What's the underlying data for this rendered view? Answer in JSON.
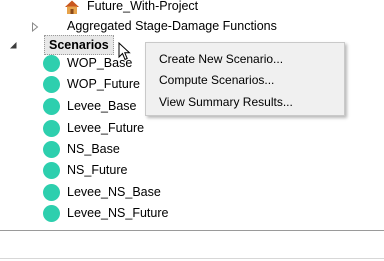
{
  "tree": {
    "partial_item": {
      "label": "Future_With-Project",
      "icon": "house-icon"
    },
    "aggregated_item": {
      "label": "Aggregated Stage-Damage Functions",
      "icon": "collapsed-triangle-icon"
    },
    "scenarios_folder": {
      "label": "Scenarios",
      "icon": "expanded-triangle-icon"
    },
    "scenarios": [
      {
        "label": "WOP_Base",
        "icon": "status-circle-icon"
      },
      {
        "label": "WOP_Future",
        "icon": "status-circle-icon"
      },
      {
        "label": "Levee_Base",
        "icon": "status-circle-icon"
      },
      {
        "label": "Levee_Future",
        "icon": "status-circle-icon"
      },
      {
        "label": "NS_Base",
        "icon": "status-circle-icon"
      },
      {
        "label": "NS_Future",
        "icon": "status-circle-icon"
      },
      {
        "label": "Levee_NS_Base",
        "icon": "status-circle-icon"
      },
      {
        "label": "Levee_NS_Future",
        "icon": "status-circle-icon"
      }
    ]
  },
  "context_menu": {
    "items": [
      {
        "label": "Create New Scenario..."
      },
      {
        "label": "Compute Scenarios..."
      },
      {
        "label": "View Summary Results..."
      }
    ]
  },
  "colors": {
    "status_circle": "#2dcfae",
    "menu_background": "#f0f0f0",
    "selection_background": "#e8e8e8"
  }
}
